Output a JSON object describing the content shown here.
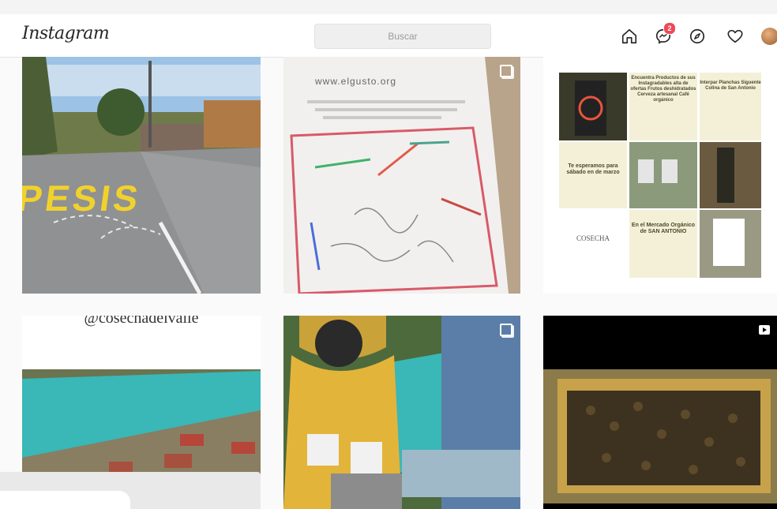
{
  "app": {
    "logo": "Instagram"
  },
  "search": {
    "placeholder": "Buscar"
  },
  "nav": {
    "items": [
      "home-icon",
      "messenger-icon",
      "explore-icon",
      "activity-heart-icon",
      "profile-avatar"
    ],
    "badge_count": "2"
  },
  "posts": [
    {
      "id": "street-pesis",
      "street_text": "PESIS",
      "multi": false
    },
    {
      "id": "poster-board",
      "site": "www.elgusto.org",
      "multi": true
    },
    {
      "id": "cosecha-collage",
      "cells": [
        "Encuentra Productos de sus Instagradables alta de ofertas Frutos deshidratados Cerveza artesanal Café orgánico",
        "Interpar Planchas Siguente Colina de San Antonio",
        "Te esperamos para sábado en de marzo",
        "COSECHA",
        "En el Mercado Orgánico de SAN ANTONIO"
      ],
      "multi": false
    },
    {
      "id": "cosecha-handle",
      "handle": "@cosechadelvalle",
      "multi": false
    },
    {
      "id": "beekeeper",
      "multi": true
    },
    {
      "id": "honeycomb-reel",
      "reel": true
    }
  ],
  "colors": {
    "accent_badge": "#ed4956",
    "bg": "#fafafa",
    "header": "#ffffff"
  }
}
